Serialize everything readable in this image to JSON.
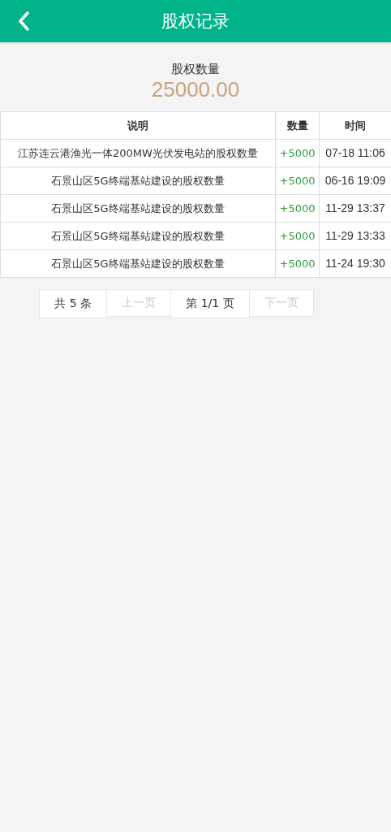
{
  "header": {
    "title": "股权记录"
  },
  "summary": {
    "label": "股权数量",
    "value": "25000.00"
  },
  "table": {
    "columns": [
      "说明",
      "数量",
      "时间"
    ],
    "rows": [
      {
        "description": "江苏连云港渔光一体200MW光伏发电站的股权数量",
        "amount": "+5000",
        "time": "07-18 11:06"
      },
      {
        "description": "石景山区5G终端基站建设的股权数量",
        "amount": "+5000",
        "time": "06-16 19:09"
      },
      {
        "description": "石景山区5G终端基站建设的股权数量",
        "amount": "+5000",
        "time": "11-29 13:37"
      },
      {
        "description": "石景山区5G终端基站建设的股权数量",
        "amount": "+5000",
        "time": "11-29 13:33"
      },
      {
        "description": "石景山区5G终端基站建设的股权数量",
        "amount": "+5000",
        "time": "11-24 19:30"
      }
    ]
  },
  "pagination": [
    {
      "kind": "info",
      "label": "共 5 条",
      "disabled": false
    },
    {
      "kind": "button",
      "label": "上一页",
      "disabled": true
    },
    {
      "kind": "info",
      "label": "第 1/1 页",
      "disabled": false
    },
    {
      "kind": "button",
      "label": "下一页",
      "disabled": true
    }
  ]
}
